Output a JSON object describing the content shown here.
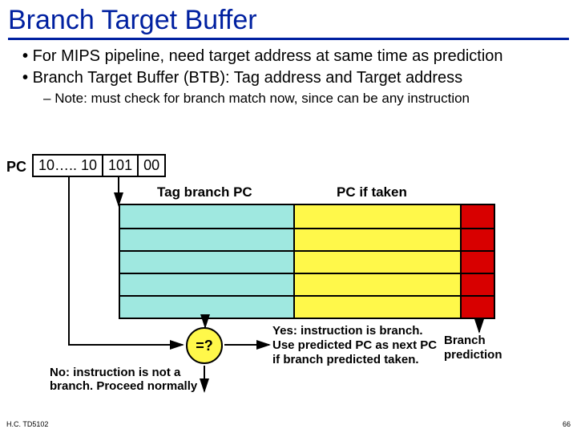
{
  "title": "Branch Target Buffer",
  "bullets": {
    "b1": "For MIPS pipeline, need target address at same time as prediction",
    "b2": "Branch Target Buffer (BTB): Tag address and Target address",
    "sub": "Note: must check for branch match now, since can be any instruction"
  },
  "pc": {
    "label": "PC",
    "seg_high": "10….. 10",
    "seg_mid": "101",
    "seg_low": "00"
  },
  "columns": {
    "tag": "Tag branch PC",
    "target": "PC if taken"
  },
  "btb_rows": 5,
  "comparator": "=?",
  "no_text": "No: instruction is not a branch. Proceed normally",
  "yes_text": "Yes: instruction is branch. Use predicted PC as next PC if branch predicted taken.",
  "branch_pred": "Branch prediction",
  "footer": {
    "left": "H.C.   TD5102",
    "right": "66"
  }
}
